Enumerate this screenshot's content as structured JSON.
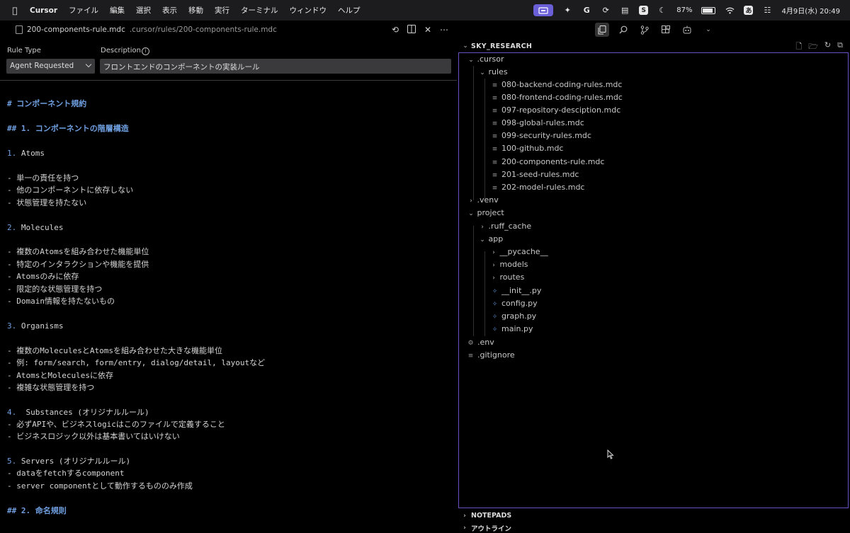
{
  "menubar": {
    "app_name": "Cursor",
    "items": [
      "ファイル",
      "編集",
      "選択",
      "表示",
      "移動",
      "実行",
      "ターミナル",
      "ウィンドウ",
      "ヘルプ"
    ],
    "battery": "87%",
    "datetime": "4月9日(水) 20:49",
    "input_mode": "あ"
  },
  "editor": {
    "file_name": "200-components-rule.mdc",
    "file_path": ".cursor/rules/200-components-rule.mdc",
    "rule_type_label": "Rule Type",
    "rule_type_value": "Agent Requested",
    "description_label": "Description",
    "description_value": "フロントエンドのコンポーネントの実装ルール"
  },
  "content": {
    "h1": "# コンポーネント規約",
    "h2_1": "## 1. コンポーネントの階層構造",
    "s1_num": "1.",
    "s1_title": " Atoms",
    "s1_items": [
      "- 単一の責任を持つ",
      "- 他のコンポーネントに依存しない",
      "- 状態管理を持たない"
    ],
    "s2_num": "2.",
    "s2_title": " Molecules",
    "s2_items": [
      "- 複数のAtomsを組み合わせた機能単位",
      "- 特定のインタラクションや機能を提供",
      "- Atomsのみに依存",
      "- 限定的な状態管理を持つ",
      "- Domain情報を持たないもの"
    ],
    "s3_num": "3.",
    "s3_title": " Organisms",
    "s3_items": [
      "- 複数のMoleculesとAtomsを組み合わせた大きな機能単位",
      "- 例: form/search, form/entry, dialog/detail, layoutなど",
      "- AtomsとMoleculesに依存",
      "- 複雑な状態管理を持つ"
    ],
    "s4_num": "4.",
    "s4_title": "  Substances (オリジナルルール)",
    "s4_items": [
      "- 必ずAPIや、ビジネスlogicはこのファイルで定義すること",
      "- ビジネスロジック以外は基本書いてはいけない"
    ],
    "s5_num": "5.",
    "s5_title": " Servers (オリジナルルール)",
    "s5_items": [
      "- dataをfetchするcomponent",
      "- server componentとして動作するもののみ作成"
    ],
    "h2_2": "## 2. 命名規則"
  },
  "explorer": {
    "title": "SKY_RESEARCH",
    "rows": [
      {
        "label": ".cursor",
        "type": "folder-open"
      },
      {
        "label": "rules",
        "type": "folder-open"
      },
      {
        "label": "080-backend-coding-rules.mdc",
        "type": "file"
      },
      {
        "label": "080-frontend-coding-rules.mdc",
        "type": "file"
      },
      {
        "label": "097-repository-desciption.mdc",
        "type": "file"
      },
      {
        "label": "098-global-rules.mdc",
        "type": "file"
      },
      {
        "label": "099-security-rules.mdc",
        "type": "file"
      },
      {
        "label": "100-github.mdc",
        "type": "file"
      },
      {
        "label": "200-components-rule.mdc",
        "type": "file"
      },
      {
        "label": "201-seed-rules.mdc",
        "type": "file"
      },
      {
        "label": "202-model-rules.mdc",
        "type": "file"
      },
      {
        "label": ".venv",
        "type": "folder"
      },
      {
        "label": "project",
        "type": "folder-open"
      },
      {
        "label": ".ruff_cache",
        "type": "folder"
      },
      {
        "label": "app",
        "type": "folder-open"
      },
      {
        "label": "__pycache__",
        "type": "folder"
      },
      {
        "label": "models",
        "type": "folder"
      },
      {
        "label": "routes",
        "type": "folder"
      },
      {
        "label": "__init__.py",
        "type": "py"
      },
      {
        "label": "config.py",
        "type": "py"
      },
      {
        "label": "graph.py",
        "type": "py"
      },
      {
        "label": "main.py",
        "type": "py"
      },
      {
        "label": ".env",
        "type": "env"
      },
      {
        "label": ".gitignore",
        "type": "file"
      }
    ],
    "notepads_label": "NOTEPADS",
    "outline_label": "アウトライン"
  },
  "colors": {
    "accent": "#6b4fc4",
    "heading": "#6f9fe0",
    "badge": "#6a5fd6"
  }
}
